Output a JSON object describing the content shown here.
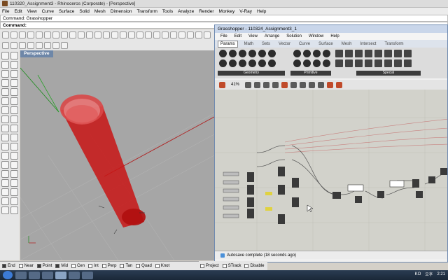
{
  "rhino": {
    "title": "110320_Assignment3 - Rhinoceros (Corporate) - [Perspective]",
    "menu": [
      "File",
      "Edit",
      "View",
      "Curve",
      "Surface",
      "Solid",
      "Mesh",
      "Dimension",
      "Transform",
      "Tools",
      "Analyze",
      "Render",
      "Monkey",
      "V-Ray",
      "Help"
    ],
    "command_history": "Command: Grasshopper",
    "command_prompt": "Command:",
    "viewport_label": "Perspective",
    "snaps": [
      {
        "label": "End",
        "on": true
      },
      {
        "label": "Near",
        "on": false
      },
      {
        "label": "Point",
        "on": true
      },
      {
        "label": "Mid",
        "on": true
      },
      {
        "label": "Cen",
        "on": false
      },
      {
        "label": "Int",
        "on": false
      },
      {
        "label": "Perp",
        "on": false
      },
      {
        "label": "Tan",
        "on": false
      },
      {
        "label": "Quad",
        "on": false
      },
      {
        "label": "Knot",
        "on": false
      },
      {
        "label": "Project",
        "on": false
      },
      {
        "label": "STrack",
        "on": false
      },
      {
        "label": "Disable",
        "on": false
      }
    ]
  },
  "grasshopper": {
    "title": "Grasshopper - 110324_Assignment3_1",
    "menu": [
      "File",
      "Edit",
      "View",
      "Arrange",
      "Solution",
      "Window",
      "Help"
    ],
    "tabs": [
      "Params",
      "Math",
      "Sets",
      "Vector",
      "Curve",
      "Surface",
      "Mesh",
      "Intersect",
      "Transform"
    ],
    "active_tab": "Params",
    "groups": [
      "Geometry",
      "Primitive",
      "Special"
    ],
    "zoom": "41%",
    "status": "Autosave complete (18 seconds ago)"
  },
  "taskbar": {
    "lang": "KO",
    "ampm": "오후",
    "time": "2:21"
  },
  "colors": {
    "cylinder": "#c81414",
    "viewport_bg": "#a6a6a6",
    "canvas_bg": "#d2d2cb",
    "viewport_tab": "#6e87a8"
  }
}
